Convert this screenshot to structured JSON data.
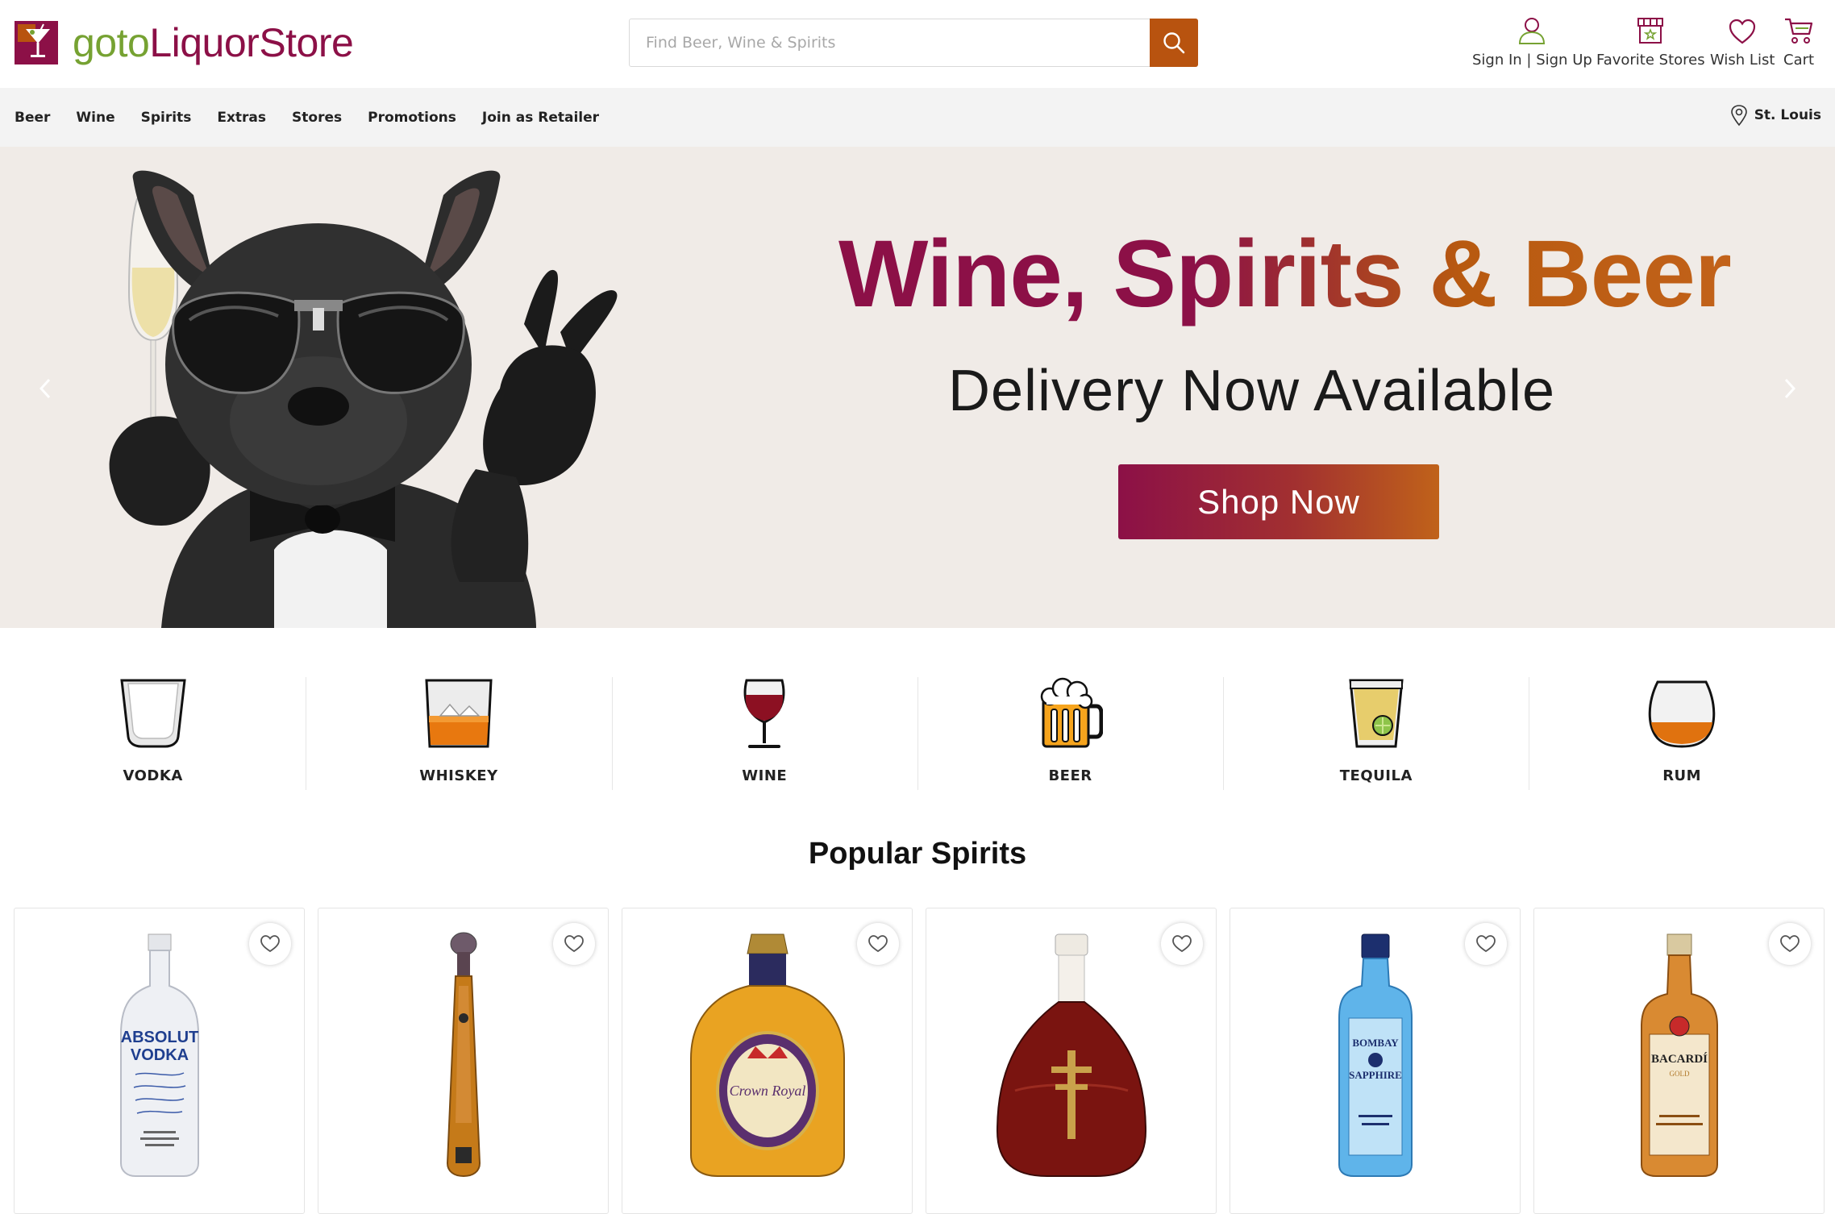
{
  "header": {
    "logo": {
      "part1": "goto",
      "part2": "LiquorStore"
    },
    "search": {
      "placeholder": "Find Beer, Wine & Spirits",
      "value": ""
    },
    "links": [
      {
        "label": "Sign In | Sign Up",
        "icon": "user-icon"
      },
      {
        "label": "Favorite Stores",
        "icon": "store-icon"
      },
      {
        "label": "Wish List",
        "icon": "heart-icon"
      },
      {
        "label": "Cart",
        "icon": "cart-icon"
      }
    ]
  },
  "nav": {
    "items": [
      "Beer",
      "Wine",
      "Spirits",
      "Extras",
      "Stores",
      "Promotions",
      "Join as Retailer"
    ],
    "location": "St. Louis"
  },
  "hero": {
    "title": "Wine, Spirits & Beer",
    "subtitle": "Delivery Now Available",
    "button": "Shop Now"
  },
  "categories": [
    {
      "label": "VODKA",
      "icon": "vodka-glass-icon"
    },
    {
      "label": "WHISKEY",
      "icon": "whiskey-glass-icon"
    },
    {
      "label": "WINE",
      "icon": "wine-glass-icon"
    },
    {
      "label": "BEER",
      "icon": "beer-mug-icon"
    },
    {
      "label": "TEQUILA",
      "icon": "tequila-shot-icon"
    },
    {
      "label": "RUM",
      "icon": "rum-glass-icon"
    }
  ],
  "popular": {
    "title": "Popular Spirits",
    "products": [
      {
        "brand_text": [
          "ABSOLUT",
          "VODKA"
        ]
      },
      {
        "brand_text": []
      },
      {
        "brand_text": [
          "Crown Royal"
        ]
      },
      {
        "brand_text": []
      },
      {
        "brand_text": [
          "BOMBAY",
          "SAPPHIRE"
        ]
      },
      {
        "brand_text": [
          "BACARDÍ",
          "GOLD"
        ]
      }
    ]
  },
  "colors": {
    "brand_purple": "#8c1047",
    "brand_green": "#76a232",
    "accent_orange": "#b8530f",
    "hero_bg": "#f0ebe7"
  }
}
